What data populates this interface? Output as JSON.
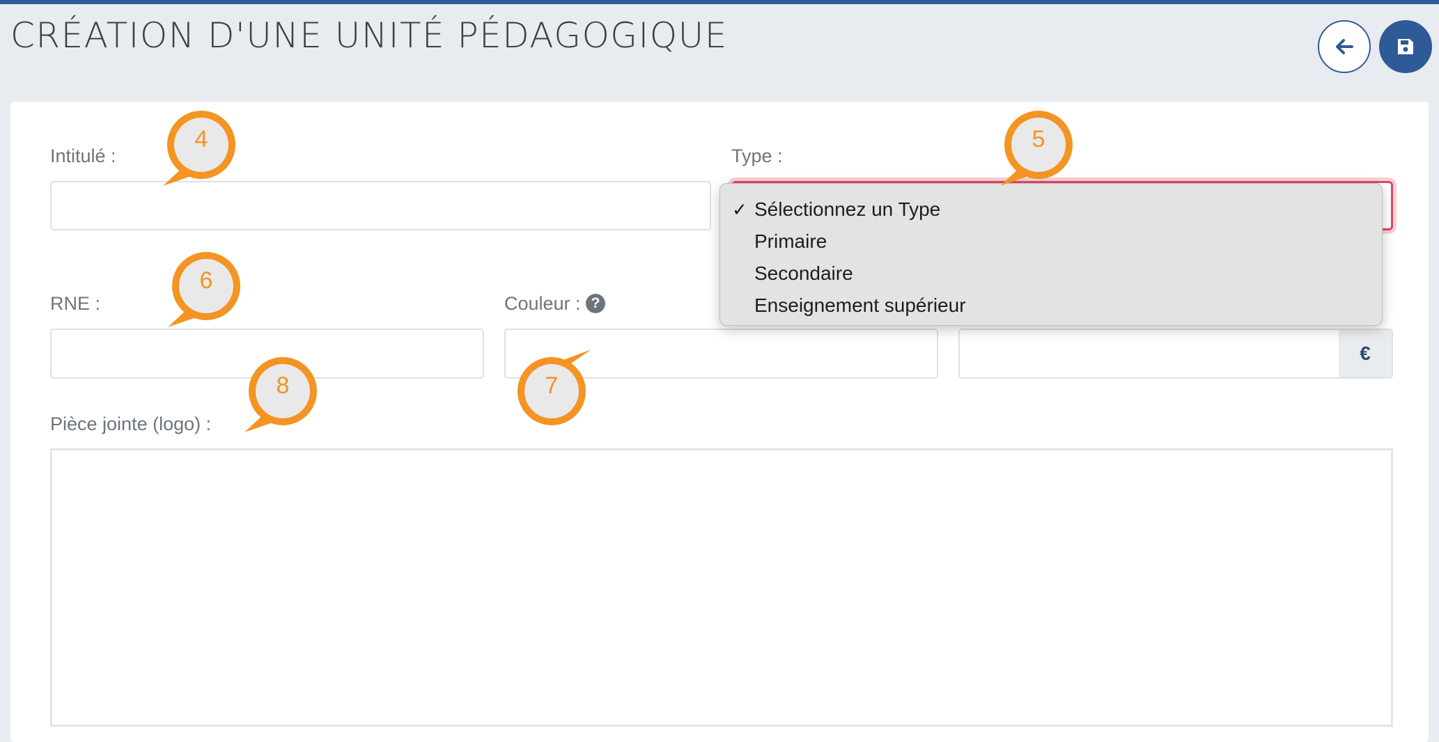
{
  "header": {
    "title": "CRÉATION D'UNE UNITÉ PÉDAGOGIQUE",
    "back_icon": "arrow-left-icon",
    "save_icon": "floppy-disk-icon",
    "accent_color": "#2f5a98"
  },
  "form": {
    "intitule_label": "Intitulé :",
    "type_label": "Type :",
    "rne_label": "RNE :",
    "couleur_label": "Couleur :",
    "couleur_help_icon": "question-circle-icon",
    "currency_addon": "€",
    "piece_jointe_label": "Pièce jointe (logo) :",
    "type_dropdown": {
      "selected": "Sélectionnez un Type",
      "check_mark": "✓",
      "options": [
        "Sélectionnez un Type",
        "Primaire",
        "Secondaire",
        "Enseignement supérieur"
      ]
    }
  },
  "callouts": [
    "4",
    "5",
    "6",
    "7",
    "8"
  ],
  "callout_color": "#f39423"
}
